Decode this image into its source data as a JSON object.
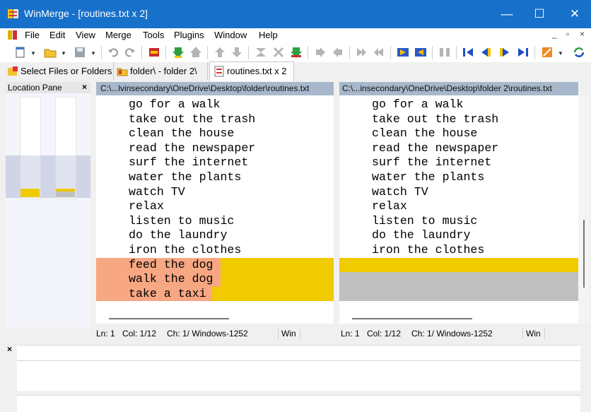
{
  "window": {
    "title": "WinMerge - [routines.txt x 2]",
    "app_icon": "winmerge-icon",
    "minimize_glyph": "—",
    "maximize_glyph": "☐",
    "close_glyph": "✕"
  },
  "menu": {
    "items": [
      "File",
      "Edit",
      "View",
      "Merge",
      "Tools",
      "Plugins",
      "Window",
      "Help"
    ],
    "mdi_controls": [
      "_",
      "▫",
      "×"
    ]
  },
  "tabs": [
    {
      "label": "Select Files or Folders",
      "icon": "select-files-icon"
    },
    {
      "label": "folder\\ - folder 2\\",
      "icon": "folder-compare-icon"
    },
    {
      "label": "routines.txt x 2",
      "icon": "text-file-icon"
    }
  ],
  "location_pane": {
    "title": "Location Pane",
    "close_glyph": "×"
  },
  "left_pane": {
    "path": "C:\\...lvinsecondary\\OneDrive\\Desktop\\folder\\routines.txt",
    "lines": [
      "go for a walk",
      "take out the trash",
      "clean the house",
      "read the newspaper",
      "surf the internet",
      "water the plants",
      "watch TV",
      "relax",
      "listen to music",
      "do the laundry",
      "iron the clothes",
      "feed the dog",
      "walk the dog",
      "take a taxi"
    ],
    "status": {
      "ln": "Ln: 1",
      "col": "Col: 1/12",
      "ch": "Ch: 1/ Windows-1252",
      "eol": "Win"
    }
  },
  "right_pane": {
    "path": "C:\\...insecondary\\OneDrive\\Desktop\\folder 2\\routines.txt",
    "lines": [
      "go for a walk",
      "take out the trash",
      "clean the house",
      "read the newspaper",
      "surf the internet",
      "water the plants",
      "watch TV",
      "relax",
      "listen to music",
      "do the laundry",
      "iron the clothes",
      "",
      "",
      ""
    ],
    "status": {
      "ln": "Ln: 1",
      "col": "Col: 1/12",
      "ch": "Ch: 1/ Windows-1252",
      "eol": "Win"
    }
  },
  "bottom_pane": {
    "close_glyph": "×"
  },
  "colors": {
    "diff_selected": "#efcb00",
    "diff_word": "#f7a782",
    "missing_lines": "#c0c0c0",
    "title_bar": "#1770c9",
    "path_bar": "#a8b8cc"
  }
}
